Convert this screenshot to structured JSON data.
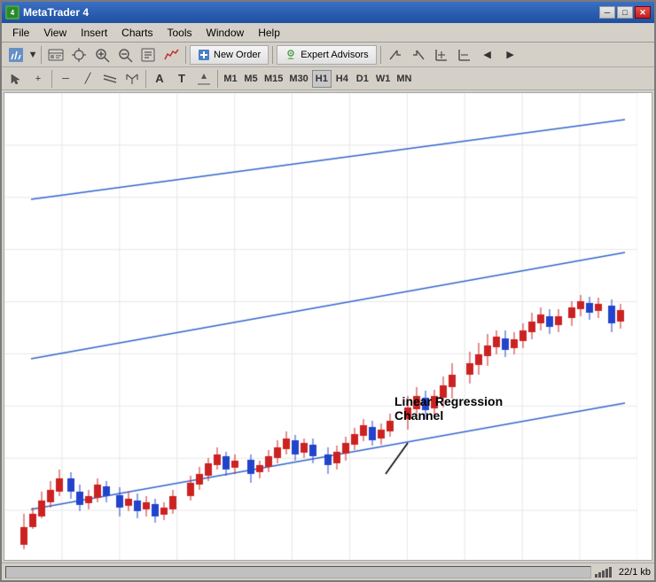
{
  "window": {
    "title": "MetaTrader 4"
  },
  "titlebar": {
    "icon_label": "MT",
    "min_btn": "─",
    "max_btn": "□",
    "close_btn": "✕"
  },
  "menu": {
    "items": [
      "File",
      "View",
      "Insert",
      "Charts",
      "Tools",
      "Window",
      "Help"
    ]
  },
  "toolbar1": {
    "new_order_label": "New Order",
    "expert_advisors_label": "Expert Advisors"
  },
  "timeframes": {
    "buttons": [
      "M1",
      "M5",
      "M15",
      "M30",
      "H1",
      "H4",
      "D1",
      "W1",
      "MN"
    ],
    "active": "H1"
  },
  "chart": {
    "annotation_label": "Linear Regression",
    "annotation_label2": "Channel"
  },
  "statusbar": {
    "info": "22/1 kb"
  }
}
